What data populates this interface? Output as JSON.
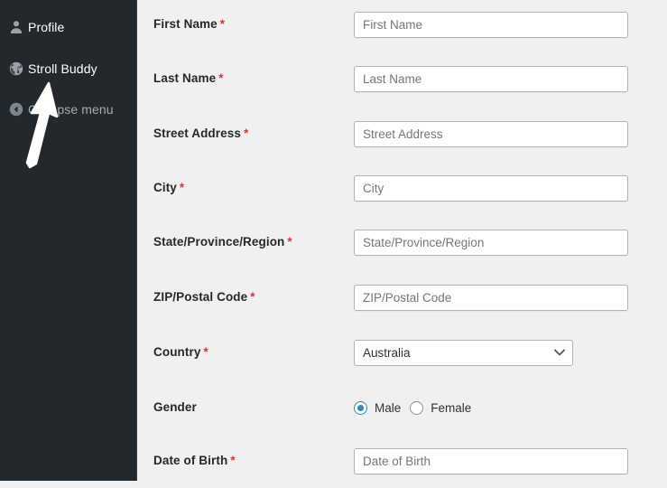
{
  "sidebar": {
    "background_color": "#23282d",
    "items": [
      {
        "label": "Profile",
        "icon": "user-icon",
        "dim": false
      },
      {
        "label": "Stroll Buddy",
        "icon": "globe-icon",
        "dim": false
      },
      {
        "label": "Collapse menu",
        "icon": "collapse-arrow-icon",
        "dim": true
      }
    ]
  },
  "annotation": {
    "type": "arrow",
    "color": "#ffffff",
    "points_to": "Stroll Buddy"
  },
  "form": {
    "required_marker": "*",
    "required_color": "#d63638",
    "accent_color": "#3582c4",
    "fields": [
      {
        "label": "First Name",
        "required": true,
        "type": "text",
        "placeholder": "First Name",
        "value": ""
      },
      {
        "label": "Last Name",
        "required": true,
        "type": "text",
        "placeholder": "Last Name",
        "value": ""
      },
      {
        "label": "Street Address",
        "required": true,
        "type": "text",
        "placeholder": "Street Address",
        "value": ""
      },
      {
        "label": "City",
        "required": true,
        "type": "text",
        "placeholder": "City",
        "value": ""
      },
      {
        "label": "State/Province/Region",
        "required": true,
        "type": "text",
        "placeholder": "State/Province/Region",
        "value": ""
      },
      {
        "label": "ZIP/Postal Code",
        "required": true,
        "type": "text",
        "placeholder": "ZIP/Postal Code",
        "value": ""
      },
      {
        "label": "Country",
        "required": true,
        "type": "select",
        "value": "Australia",
        "options": [
          "Australia"
        ]
      },
      {
        "label": "Gender",
        "required": false,
        "type": "radio",
        "options": [
          "Male",
          "Female"
        ],
        "selected": "Male"
      },
      {
        "label": "Date of Birth",
        "required": true,
        "type": "text",
        "placeholder": "Date of Birth",
        "value": ""
      }
    ]
  }
}
